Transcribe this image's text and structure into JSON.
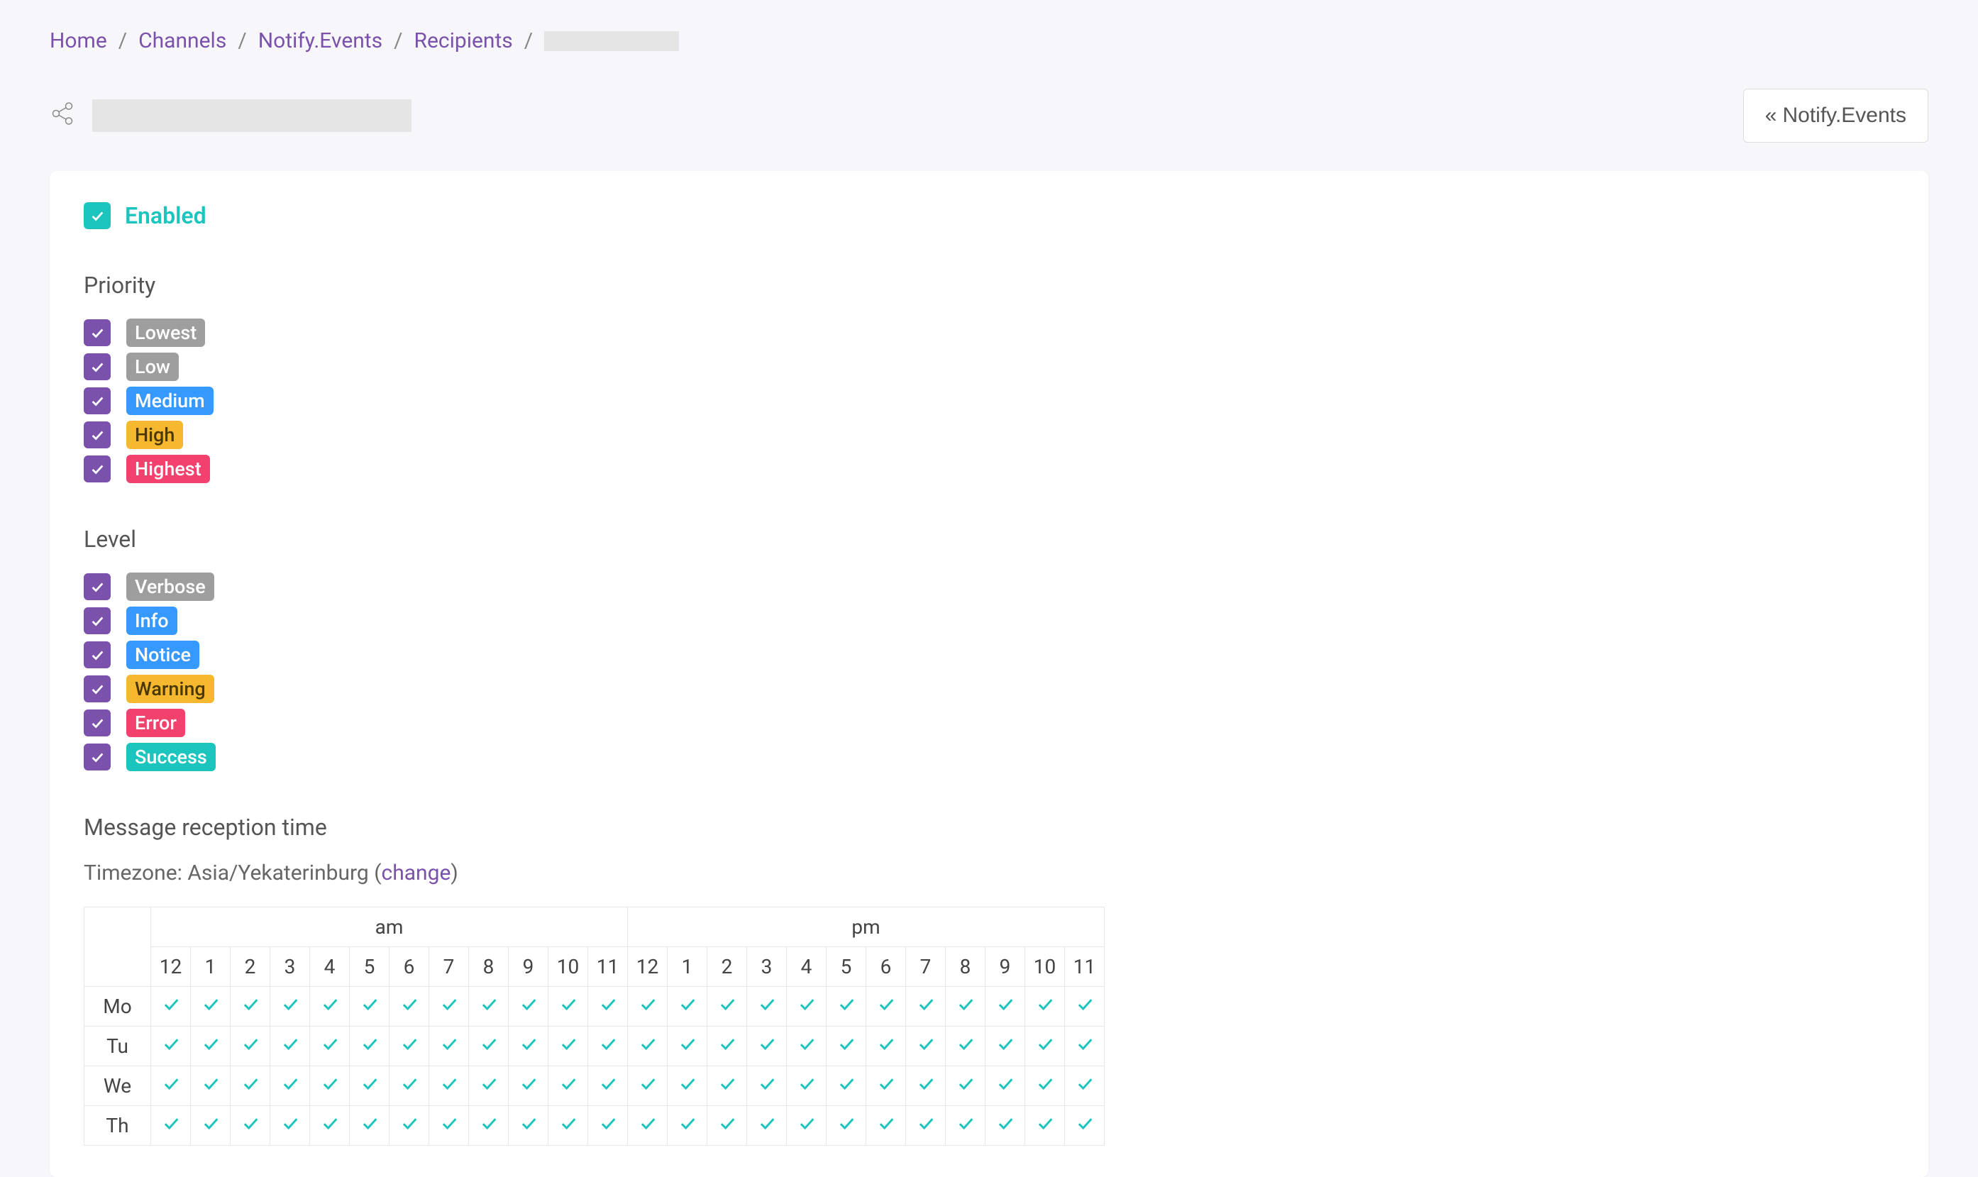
{
  "breadcrumb": {
    "items": [
      "Home",
      "Channels",
      "Notify.Events",
      "Recipients"
    ]
  },
  "header": {
    "back_button": "Notify.Events"
  },
  "enabled_label": "Enabled",
  "sections": {
    "priority_title": "Priority",
    "level_title": "Level",
    "message_time_title": "Message reception time",
    "timezone_prefix": "Timezone: ",
    "timezone_value": "Asia/Yekaterinburg",
    "change_link": "change"
  },
  "priorities": [
    {
      "label": "Lowest",
      "color": "gray"
    },
    {
      "label": "Low",
      "color": "gray"
    },
    {
      "label": "Medium",
      "color": "blue"
    },
    {
      "label": "High",
      "color": "yellow"
    },
    {
      "label": "Highest",
      "color": "pink"
    }
  ],
  "levels": [
    {
      "label": "Verbose",
      "color": "gray"
    },
    {
      "label": "Info",
      "color": "blue"
    },
    {
      "label": "Notice",
      "color": "blue"
    },
    {
      "label": "Warning",
      "color": "yellow"
    },
    {
      "label": "Error",
      "color": "pink"
    },
    {
      "label": "Success",
      "color": "teal"
    }
  ],
  "schedule": {
    "am_label": "am",
    "pm_label": "pm",
    "hours": [
      "12",
      "1",
      "2",
      "3",
      "4",
      "5",
      "6",
      "7",
      "8",
      "9",
      "10",
      "11",
      "12",
      "1",
      "2",
      "3",
      "4",
      "5",
      "6",
      "7",
      "8",
      "9",
      "10",
      "11"
    ],
    "days": [
      "Mo",
      "Tu",
      "We",
      "Th"
    ]
  }
}
